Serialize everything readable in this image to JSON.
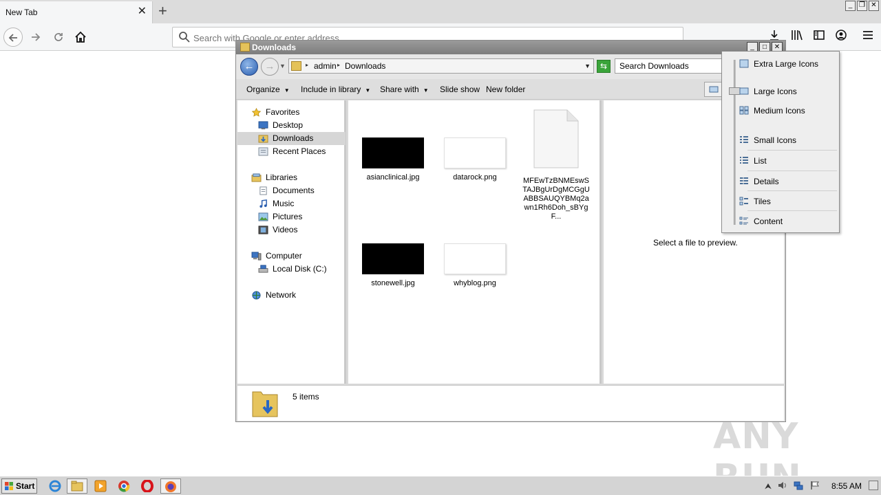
{
  "browser": {
    "tab_title": "New Tab",
    "url_placeholder": "Search with Google or enter address"
  },
  "explorer": {
    "title": "Downloads",
    "breadcrumb": [
      "admin",
      "Downloads"
    ],
    "search_placeholder": "Search Downloads",
    "toolbar": {
      "organize": "Organize",
      "include": "Include in library",
      "share": "Share with",
      "slideshow": "Slide show",
      "newfolder": "New folder"
    },
    "nav": {
      "favorites": "Favorites",
      "desktop": "Desktop",
      "downloads": "Downloads",
      "recent": "Recent Places",
      "libraries": "Libraries",
      "documents": "Documents",
      "music": "Music",
      "pictures": "Pictures",
      "videos": "Videos",
      "computer": "Computer",
      "localdisk": "Local Disk (C:)",
      "network": "Network"
    },
    "files": [
      {
        "name": "asianclinical.jpg",
        "thumb": "black"
      },
      {
        "name": "datarock.png",
        "thumb": "white"
      },
      {
        "name": "MFEwTzBNMEswSTAJBgUrDgMCGgUABBSAUQYBMq2awn1Rh6Doh_sBYgF...",
        "thumb": "document"
      },
      {
        "name": "stonewell.jpg",
        "thumb": "black"
      },
      {
        "name": "whyblog.png",
        "thumb": "white"
      }
    ],
    "preview_text": "Select a file to preview.",
    "status": "5 items"
  },
  "view_menu": {
    "items": [
      "Extra Large Icons",
      "Large Icons",
      "Medium Icons",
      "Small Icons",
      "List",
      "Details",
      "Tiles",
      "Content"
    ],
    "selected": "Large Icons"
  },
  "taskbar": {
    "start": "Start",
    "time": "8:55 AM"
  },
  "watermark": "ANY RUN"
}
